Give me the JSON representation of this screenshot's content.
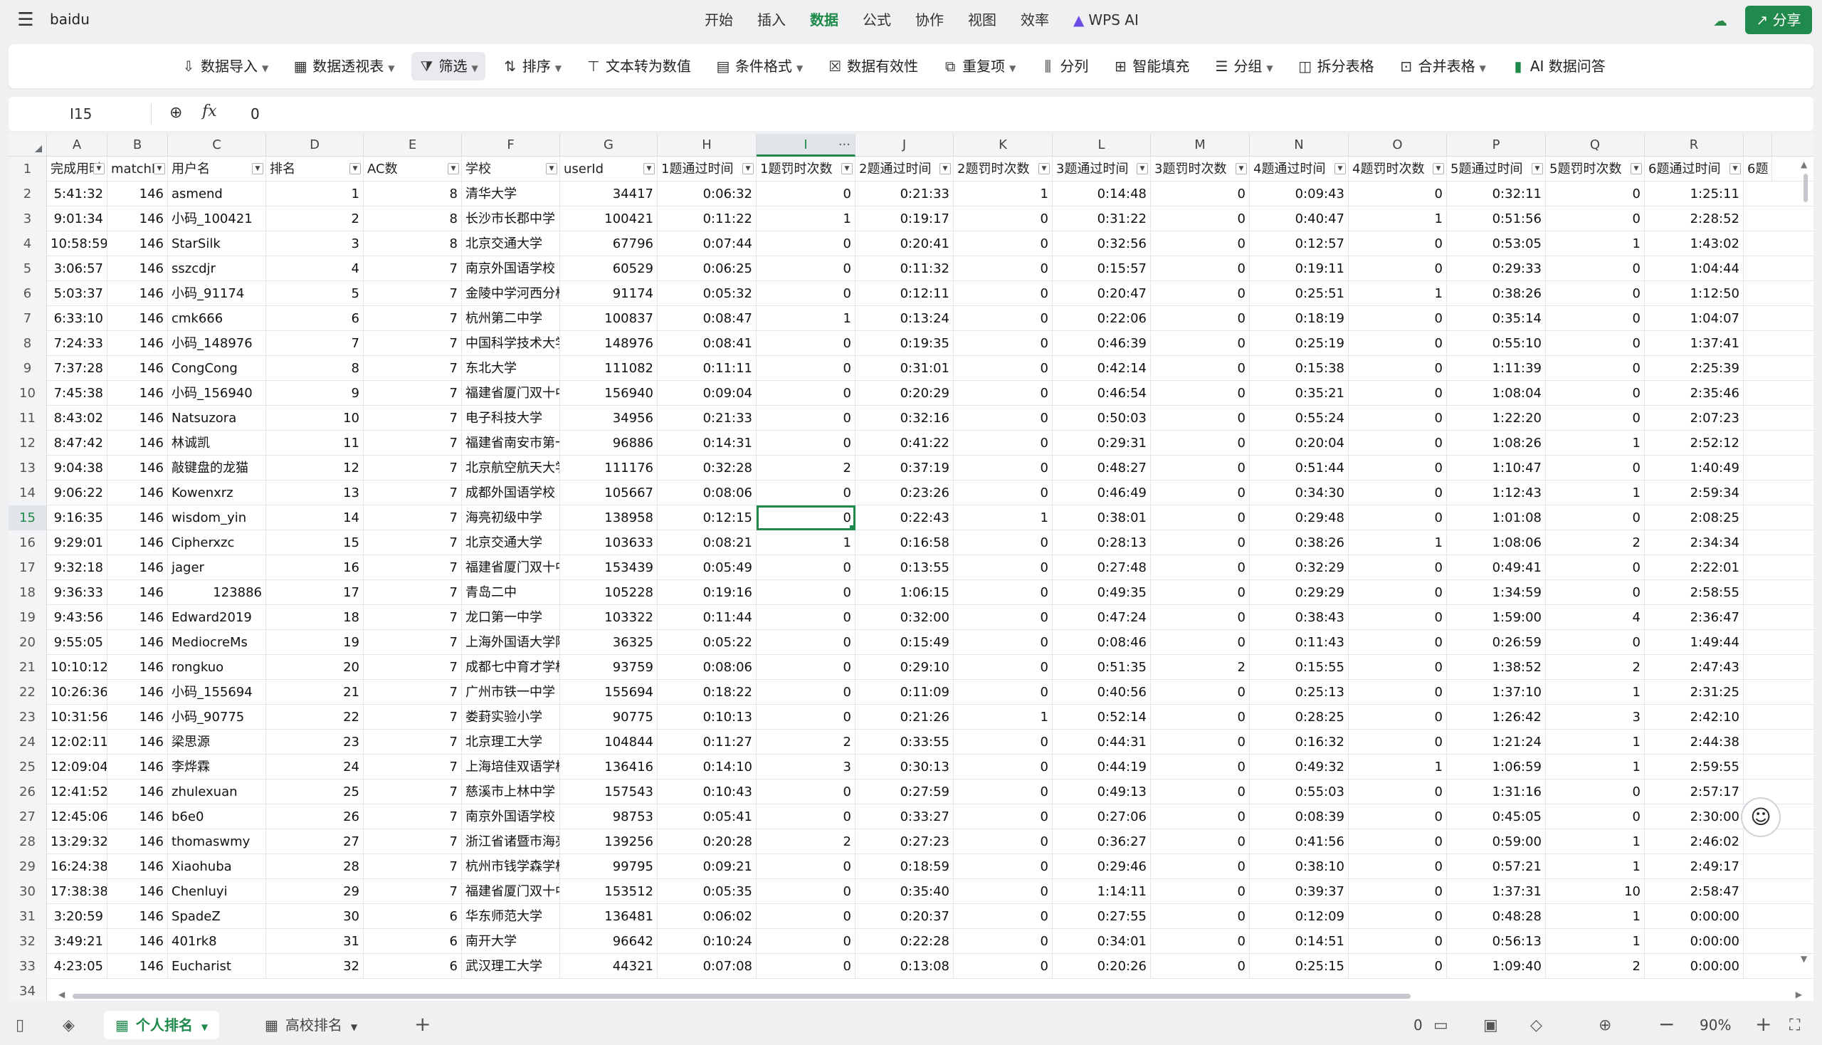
{
  "titlebar": {
    "doc_name": "baidu",
    "tabs": [
      "开始",
      "插入",
      "数据",
      "公式",
      "协作",
      "视图",
      "效率",
      "WPS AI"
    ],
    "active_tab": "数据",
    "share_label": "分享"
  },
  "ribbon": [
    {
      "icon": "import-icon",
      "glyph": "⇩",
      "label": "数据导入",
      "caret": true
    },
    {
      "icon": "pivot-table-icon",
      "glyph": "▦",
      "label": "数据透视表",
      "caret": true
    },
    {
      "icon": "filter-icon",
      "glyph": "⧩",
      "label": "筛选",
      "caret": true,
      "active": true
    },
    {
      "icon": "sort-icon",
      "glyph": "⇅",
      "label": "排序",
      "caret": true
    },
    {
      "icon": "text-to-number-icon",
      "glyph": "⊤",
      "label": "文本转为数值",
      "caret": false
    },
    {
      "icon": "conditional-format-icon",
      "glyph": "▤",
      "label": "条件格式",
      "caret": true
    },
    {
      "icon": "data-validation-icon",
      "glyph": "☒",
      "label": "数据有效性",
      "caret": false
    },
    {
      "icon": "duplicates-icon",
      "glyph": "⧉",
      "label": "重复项",
      "caret": true
    },
    {
      "icon": "split-column-icon",
      "glyph": "⫼",
      "label": "分列",
      "caret": false
    },
    {
      "icon": "smart-fill-icon",
      "glyph": "⊞",
      "label": "智能填充",
      "caret": false
    },
    {
      "icon": "group-icon",
      "glyph": "☰",
      "label": "分组",
      "caret": true
    },
    {
      "icon": "split-table-icon",
      "glyph": "◫",
      "label": "拆分表格",
      "caret": false
    },
    {
      "icon": "merge-table-icon",
      "glyph": "⊡",
      "label": "合并表格",
      "caret": true
    },
    {
      "icon": "ai-data-qa-icon",
      "glyph": "▮",
      "label": "AI 数据问答",
      "caret": false
    }
  ],
  "formula_bar": {
    "cell_ref": "I15",
    "fx": "fx",
    "value": "0"
  },
  "columns": [
    "A",
    "B",
    "C",
    "D",
    "E",
    "F",
    "G",
    "H",
    "I",
    "J",
    "K",
    "L",
    "M",
    "N",
    "O",
    "P",
    "Q",
    "R"
  ],
  "headers": [
    "完成用时",
    "matchId",
    "用户名",
    "排名",
    "AC数",
    "学校",
    "userId",
    "1题通过时间",
    "1题罚时次数",
    "2题通过时间",
    "2题罚时次数",
    "3题通过时间",
    "3题罚时次数",
    "4题通过时间",
    "4题罚时次数",
    "5题通过时间",
    "5题罚时次数",
    "6题通过时间"
  ],
  "header_overflow": "6题",
  "rows": [
    [
      "5:41:32",
      "146",
      "asmend",
      "1",
      "8",
      "清华大学",
      "34417",
      "0:06:32",
      "0",
      "0:21:33",
      "1",
      "0:14:48",
      "0",
      "0:09:43",
      "0",
      "0:32:11",
      "0",
      "1:25:11"
    ],
    [
      "9:01:34",
      "146",
      "小码_100421",
      "2",
      "8",
      "长沙市长郡中学",
      "100421",
      "0:11:22",
      "1",
      "0:19:17",
      "0",
      "0:31:22",
      "0",
      "0:40:47",
      "1",
      "0:51:56",
      "0",
      "2:28:52"
    ],
    [
      "10:58:59",
      "146",
      "StarSilk",
      "3",
      "8",
      "北京交通大学",
      "67796",
      "0:07:44",
      "0",
      "0:20:41",
      "0",
      "0:32:56",
      "0",
      "0:12:57",
      "0",
      "0:53:05",
      "1",
      "1:43:02"
    ],
    [
      "3:06:57",
      "146",
      "sszcdjr",
      "4",
      "7",
      "南京外国语学校",
      "60529",
      "0:06:25",
      "0",
      "0:11:32",
      "0",
      "0:15:57",
      "0",
      "0:19:11",
      "0",
      "0:29:33",
      "0",
      "1:04:44"
    ],
    [
      "5:03:37",
      "146",
      "小码_91174",
      "5",
      "7",
      "金陵中学河西分校",
      "91174",
      "0:05:32",
      "0",
      "0:12:11",
      "0",
      "0:20:47",
      "0",
      "0:25:51",
      "1",
      "0:38:26",
      "0",
      "1:12:50"
    ],
    [
      "6:33:10",
      "146",
      "cmk666",
      "6",
      "7",
      "杭州第二中学",
      "100837",
      "0:08:47",
      "1",
      "0:13:24",
      "0",
      "0:22:06",
      "0",
      "0:18:19",
      "0",
      "0:35:14",
      "0",
      "1:04:07"
    ],
    [
      "7:24:33",
      "146",
      "小码_148976",
      "7",
      "7",
      "中国科学技术大学",
      "148976",
      "0:08:41",
      "0",
      "0:19:35",
      "0",
      "0:46:39",
      "0",
      "0:25:19",
      "0",
      "0:55:10",
      "0",
      "1:37:41"
    ],
    [
      "7:37:28",
      "146",
      "CongCong",
      "8",
      "7",
      "东北大学",
      "111082",
      "0:11:11",
      "0",
      "0:31:01",
      "0",
      "0:42:14",
      "0",
      "0:15:38",
      "0",
      "1:11:39",
      "0",
      "2:25:39"
    ],
    [
      "7:45:38",
      "146",
      "小码_156940",
      "9",
      "7",
      "福建省厦门双十中学",
      "156940",
      "0:09:04",
      "0",
      "0:20:29",
      "0",
      "0:46:54",
      "0",
      "0:35:21",
      "0",
      "1:08:04",
      "0",
      "2:35:46"
    ],
    [
      "8:43:02",
      "146",
      "Natsuzora",
      "10",
      "7",
      "电子科技大学",
      "34956",
      "0:21:33",
      "0",
      "0:32:16",
      "0",
      "0:50:03",
      "0",
      "0:55:24",
      "0",
      "1:22:20",
      "0",
      "2:07:23"
    ],
    [
      "8:47:42",
      "146",
      "林诚凯",
      "11",
      "7",
      "福建省南安市第一中学",
      "96886",
      "0:14:31",
      "0",
      "0:41:22",
      "0",
      "0:29:31",
      "0",
      "0:20:04",
      "0",
      "1:08:26",
      "1",
      "2:52:12"
    ],
    [
      "9:04:38",
      "146",
      "敲键盘的龙猫",
      "12",
      "7",
      "北京航空航天大学",
      "111176",
      "0:32:28",
      "2",
      "0:37:19",
      "0",
      "0:48:27",
      "0",
      "0:51:44",
      "0",
      "1:10:47",
      "0",
      "1:40:49"
    ],
    [
      "9:06:22",
      "146",
      "Kowenxrz",
      "13",
      "7",
      "成都外国语学校",
      "105667",
      "0:08:06",
      "0",
      "0:23:26",
      "0",
      "0:46:49",
      "0",
      "0:34:30",
      "0",
      "1:12:43",
      "1",
      "2:59:34"
    ],
    [
      "9:16:35",
      "146",
      "wisdom_yin",
      "14",
      "7",
      "海亮初级中学",
      "138958",
      "0:12:15",
      "0",
      "0:22:43",
      "1",
      "0:38:01",
      "0",
      "0:29:48",
      "0",
      "1:01:08",
      "0",
      "2:08:25"
    ],
    [
      "9:29:01",
      "146",
      "Cipherxzc",
      "15",
      "7",
      "北京交通大学",
      "103633",
      "0:08:21",
      "1",
      "0:16:58",
      "0",
      "0:28:13",
      "0",
      "0:38:26",
      "1",
      "1:08:06",
      "2",
      "2:34:34"
    ],
    [
      "9:32:18",
      "146",
      "jager",
      "16",
      "7",
      "福建省厦门双十中学",
      "153439",
      "0:05:49",
      "0",
      "0:13:55",
      "0",
      "0:27:48",
      "0",
      "0:32:29",
      "0",
      "0:49:41",
      "0",
      "2:22:01"
    ],
    [
      "9:36:33",
      "146",
      "123886",
      "17",
      "7",
      "青岛二中",
      "105228",
      "0:19:16",
      "0",
      "1:06:15",
      "0",
      "0:49:35",
      "0",
      "0:29:29",
      "0",
      "1:34:59",
      "0",
      "2:58:55"
    ],
    [
      "9:43:56",
      "146",
      "Edward2019",
      "18",
      "7",
      "龙口第一中学",
      "103322",
      "0:11:44",
      "0",
      "0:32:00",
      "0",
      "0:47:24",
      "0",
      "0:38:43",
      "0",
      "1:59:00",
      "4",
      "2:36:47"
    ],
    [
      "9:55:05",
      "146",
      "MediocreMs",
      "19",
      "7",
      "上海外国语大学附属",
      "36325",
      "0:05:22",
      "0",
      "0:15:49",
      "0",
      "0:08:46",
      "0",
      "0:11:43",
      "0",
      "0:26:59",
      "0",
      "1:49:44"
    ],
    [
      "10:10:12",
      "146",
      "rongkuo",
      "20",
      "7",
      "成都七中育才学校",
      "93759",
      "0:08:06",
      "0",
      "0:29:10",
      "0",
      "0:51:35",
      "2",
      "0:15:55",
      "0",
      "1:38:52",
      "2",
      "2:47:43"
    ],
    [
      "10:26:36",
      "146",
      "小码_155694",
      "21",
      "7",
      "广州市铁一中学",
      "155694",
      "0:18:22",
      "0",
      "0:11:09",
      "0",
      "0:40:56",
      "0",
      "0:25:13",
      "0",
      "1:37:10",
      "1",
      "2:31:25"
    ],
    [
      "10:31:56",
      "146",
      "小码_90775",
      "22",
      "7",
      "娄葑实验小学",
      "90775",
      "0:10:13",
      "0",
      "0:21:26",
      "1",
      "0:52:14",
      "0",
      "0:28:25",
      "0",
      "1:26:42",
      "3",
      "2:42:10"
    ],
    [
      "12:02:11",
      "146",
      "梁思源",
      "23",
      "7",
      "北京理工大学",
      "104844",
      "0:11:27",
      "2",
      "0:33:55",
      "0",
      "0:44:31",
      "0",
      "0:16:32",
      "0",
      "1:21:24",
      "1",
      "2:44:38"
    ],
    [
      "12:09:04",
      "146",
      "李烨霖",
      "24",
      "7",
      "上海培佳双语学校",
      "136416",
      "0:14:10",
      "3",
      "0:30:13",
      "0",
      "0:44:19",
      "0",
      "0:49:32",
      "1",
      "1:06:59",
      "1",
      "2:59:55"
    ],
    [
      "12:41:52",
      "146",
      "zhulexuan",
      "25",
      "7",
      "慈溪市上林中学",
      "157543",
      "0:10:43",
      "0",
      "0:27:59",
      "0",
      "0:49:13",
      "0",
      "0:55:03",
      "0",
      "1:31:16",
      "0",
      "2:57:17"
    ],
    [
      "12:45:06",
      "146",
      "b6e0",
      "26",
      "7",
      "南京外国语学校",
      "98753",
      "0:05:41",
      "0",
      "0:33:27",
      "0",
      "0:27:06",
      "0",
      "0:08:39",
      "0",
      "0:45:05",
      "0",
      "2:30:00"
    ],
    [
      "13:29:32",
      "146",
      "thomaswmy",
      "27",
      "7",
      "浙江省诸暨市海亮",
      "139256",
      "0:20:28",
      "2",
      "0:27:23",
      "0",
      "0:36:27",
      "0",
      "0:41:56",
      "0",
      "0:59:00",
      "1",
      "2:46:02"
    ],
    [
      "16:24:38",
      "146",
      "Xiaohuba",
      "28",
      "7",
      "杭州市钱学森学校",
      "99795",
      "0:09:21",
      "0",
      "0:18:59",
      "0",
      "0:29:46",
      "0",
      "0:38:10",
      "0",
      "0:57:21",
      "1",
      "2:49:17"
    ],
    [
      "17:38:38",
      "146",
      "Chenluyi",
      "29",
      "7",
      "福建省厦门双十中学",
      "153512",
      "0:05:35",
      "0",
      "0:35:40",
      "0",
      "1:14:11",
      "0",
      "0:39:37",
      "0",
      "1:37:31",
      "10",
      "2:58:47"
    ],
    [
      "3:20:59",
      "146",
      "SpadeZ",
      "30",
      "6",
      "华东师范大学",
      "136481",
      "0:06:02",
      "0",
      "0:20:37",
      "0",
      "0:27:55",
      "0",
      "0:12:09",
      "0",
      "0:48:28",
      "1",
      "0:00:00"
    ],
    [
      "3:49:21",
      "146",
      "401rk8",
      "31",
      "6",
      "南开大学",
      "96642",
      "0:10:24",
      "0",
      "0:22:28",
      "0",
      "0:34:01",
      "0",
      "0:14:51",
      "0",
      "0:56:13",
      "1",
      "0:00:00"
    ],
    [
      "4:23:05",
      "146",
      "Eucharist",
      "32",
      "6",
      "武汉理工大学",
      "44321",
      "0:07:08",
      "0",
      "0:13:08",
      "0",
      "0:20:26",
      "0",
      "0:25:15",
      "0",
      "1:09:40",
      "2",
      "0:00:00"
    ]
  ],
  "row_numbers_extra": "34",
  "sheets": [
    {
      "label": "个人排名",
      "active": true
    },
    {
      "label": "高校排名",
      "active": false
    }
  ],
  "statusbar": {
    "count": "0",
    "zoom": "90%"
  }
}
